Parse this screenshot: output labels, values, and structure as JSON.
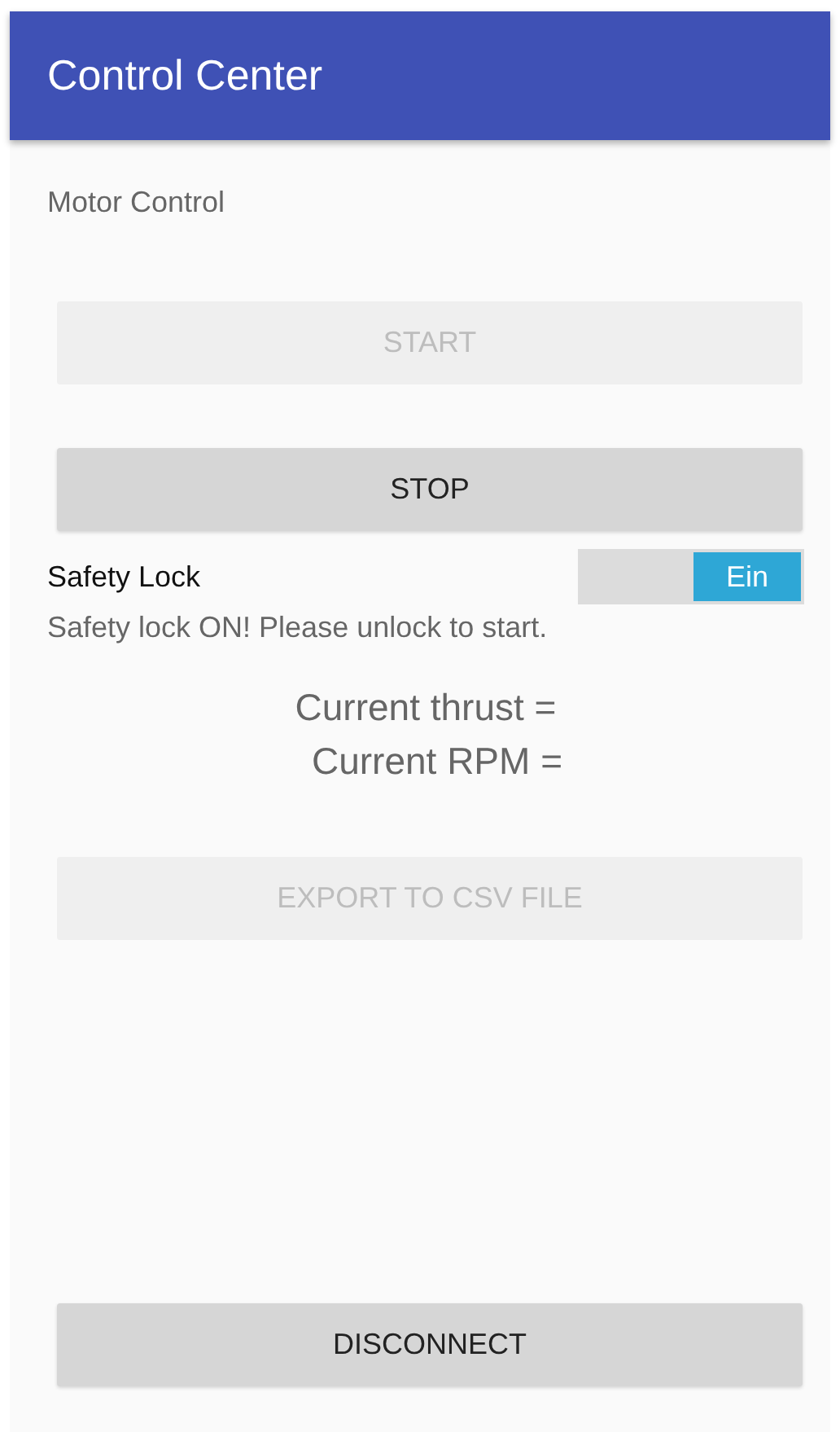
{
  "app_bar": {
    "title": "Control Center"
  },
  "section_label": "Motor Control",
  "buttons_top": [
    {
      "label": "START",
      "disabled": true
    },
    {
      "label": "STOP",
      "disabled": false
    }
  ],
  "safety_lock": {
    "label": "Safety Lock",
    "on": true,
    "switch_text": "Ein"
  },
  "status_message": "Safety lock ON! Please unlock to start.",
  "readings": [
    "Current thrust =",
    "Current RPM ="
  ],
  "export_button": {
    "label": "EXPORT TO CSV FILE",
    "disabled": true
  },
  "disconnect_button": {
    "label": "DISCONNECT",
    "disabled": false
  }
}
